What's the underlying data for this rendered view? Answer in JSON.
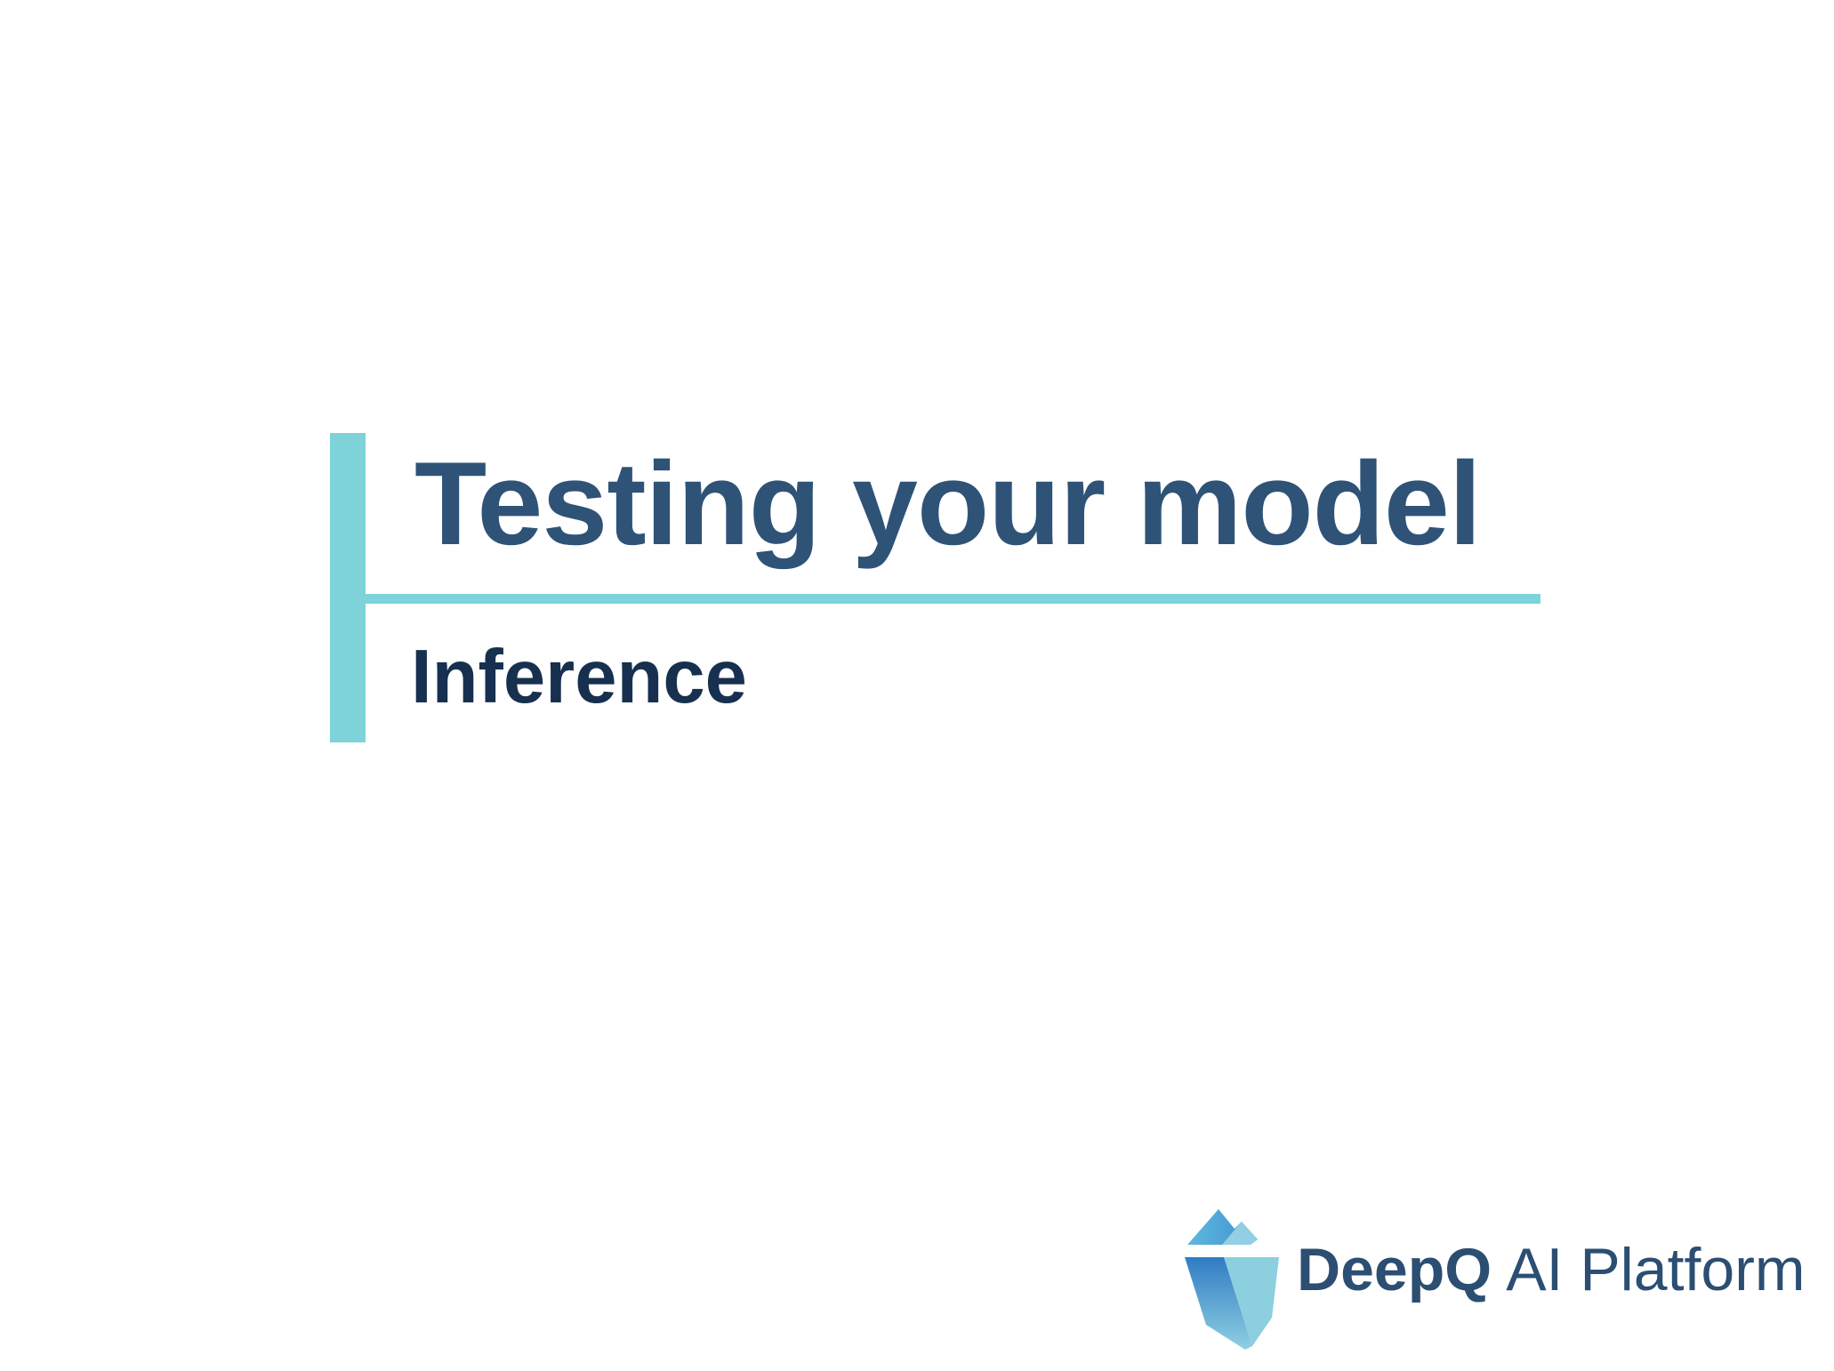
{
  "slide": {
    "title": "Testing your model",
    "subtitle": "Inference"
  },
  "logo": {
    "brand": "DeepQ",
    "product": "AI Platform",
    "icon": "iceberg-icon"
  },
  "colors": {
    "accent": "#7dd3d9",
    "title": "#2e5377",
    "subtitle": "#17304f",
    "logo_text": "#2b4e72"
  }
}
